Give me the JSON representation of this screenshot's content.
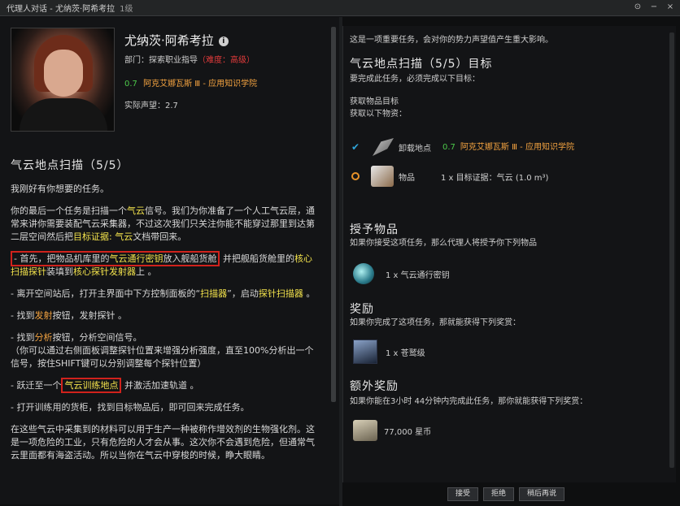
{
  "window": {
    "title": "代理人对话 - 尤纳茨·阿希考拉",
    "level": "1级",
    "btn_info": "⊙",
    "btn_min": "−",
    "btn_close": "×"
  },
  "agent": {
    "name": "尤纳茨·阿希考拉",
    "dept_prefix": "部门：探索职业指导",
    "difficulty": "（难度：高级）",
    "security": "0.7",
    "location": "阿克艾娜瓦斯 Ⅲ - 应用知识学院",
    "standing": "实际声望：2.7"
  },
  "mission": {
    "title": "气云地点扫描（5/5）",
    "p1": "我刚好有你想要的任务。",
    "p2a": "你的最后一个任务是扫描一个",
    "p2_kw1": "气云",
    "p2b": "信号。我们为你准备了一个人工气云层，通常来讲你需要装配气云采集器，不过这次我们只关注你能不能穿过那里到达第二层空间然后把",
    "p2_kw2": "目标证据: 气云",
    "p2c": "文档带回来。",
    "p3a": "- 首先，把物品机库里的",
    "p3_kw1": "气云通行密钥",
    "p3b": "放入舰船货舱",
    "p3c": " 并把舰船货舱里的",
    "p3_kw2": "核心扫描探针",
    "p3d": "装填到",
    "p3_kw3": "核心探针发射器",
    "p3e": "上 。",
    "p4a": "- 离开空间站后，打开主界面中下方控制面板的“",
    "p4_kw1": "扫描器",
    "p4b": "”，启动",
    "p4_kw2": "探针扫描器",
    "p4c": " 。",
    "p5a": "- 找到",
    "p5_kw": "发射",
    "p5b": "按钮，发射探针 。",
    "p6a": "- 找到",
    "p6_kw": "分析",
    "p6b": "按钮，分析空间信号。",
    "p6c": "（你可以通过右侧面板调整探针位置来增强分析强度，直至100%分析出一个信号，按住SHIFT键可以分别调整每个探针位置）",
    "p7a": "- 跃迁至一个",
    "p7_kw": "气云训练地点",
    "p7b": " 并激活加速轨道 。",
    "p8": "- 打开训练用的货柜，找到目标物品后，即可回来完成任务。",
    "p9": "在这些气云中采集到的材料可以用于生产一种被称作增效剂的生物强化剂。这是一项危险的工业，只有危险的人才会从事。这次你不会遇到危险，但通常气云里面都有海盗活动。所以当你在气云中穿梭的时候，睁大眼睛。"
  },
  "details": {
    "intro": "这是一项重要任务，会对你的势力声望值产生重大影响。",
    "obj_title": "气云地点扫描（5/5）目标",
    "obj_sub": "要完成此任务，必须完成以下目标：",
    "obj_fetch1": "获取物品目标",
    "obj_fetch2": "获取以下物资：",
    "row1_label": "卸载地点",
    "row1_sec": "0.7",
    "row1_loc": "阿克艾娜瓦斯 Ⅲ - 应用知识学院",
    "row2_label": "物品",
    "row2_value": "1 x 目标证据：气云 (1.0 m³)",
    "grant_title": "授予物品",
    "grant_sub": "如果你接受这项任务，那么代理人将授予你下列物品",
    "grant_item": "1 x 气云通行密钥",
    "reward_title": "奖励",
    "reward_sub": "如果你完成了这项任务，那就能获得下列奖赏：",
    "reward_item": "1 x 苍鹫级",
    "bonus_title": "额外奖励",
    "bonus_sub": "如果你能在3小时 44分钟内完成此任务，那你就能获得下列奖赏：",
    "bonus_item": "77,000 星币"
  },
  "buttons": {
    "accept": "接受",
    "decline": "拒绝",
    "later": "稍后再说"
  }
}
